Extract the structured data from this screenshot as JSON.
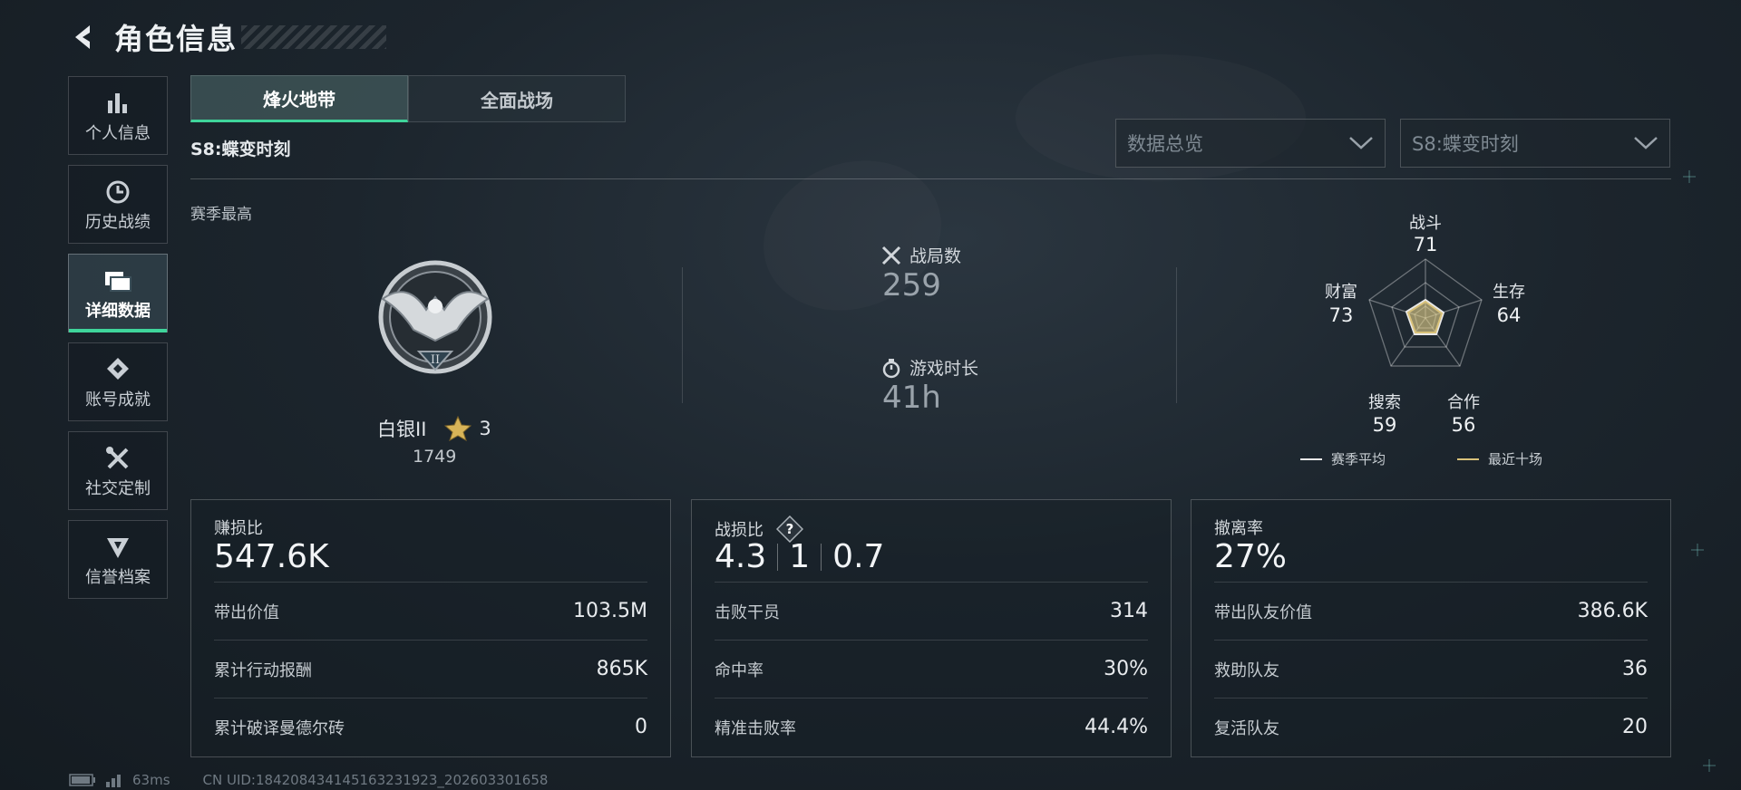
{
  "header": {
    "title": "角色信息"
  },
  "sidebar": {
    "items": [
      {
        "label": "个人信息",
        "icon": "bar-chart-icon"
      },
      {
        "label": "历史战绩",
        "icon": "history-clock-icon"
      },
      {
        "label": "详细数据",
        "icon": "folders-icon",
        "active": true
      },
      {
        "label": "账号成就",
        "icon": "achievement-medal-icon"
      },
      {
        "label": "社交定制",
        "icon": "tools-icon"
      },
      {
        "label": "信誉档案",
        "icon": "credit-shield-icon"
      }
    ]
  },
  "tabs": [
    {
      "label": "烽火地带",
      "active": true
    },
    {
      "label": "全面战场",
      "active": false
    }
  ],
  "season": {
    "label": "S8:蝶变时刻"
  },
  "filters": {
    "category": "数据总览",
    "season": "S8:蝶变时刻"
  },
  "season_best": {
    "label": "赛季最高",
    "rank_name": "白银II",
    "rank_badge_numeral": "II",
    "stars": "3",
    "score": "1749"
  },
  "stats": {
    "matches_label": "战局数",
    "matches_value": "259",
    "playtime_label": "游戏时长",
    "playtime_value": "41h"
  },
  "radar": {
    "axes": [
      {
        "label": "战斗",
        "value": "71"
      },
      {
        "label": "生存",
        "value": "64"
      },
      {
        "label": "合作",
        "value": "56"
      },
      {
        "label": "搜索",
        "value": "59"
      },
      {
        "label": "财富",
        "value": "73"
      }
    ],
    "legend_avg": "赛季平均",
    "legend_recent": "最近十场",
    "avg_color": "#e8e8e8",
    "recent_color": "#d9c27a"
  },
  "cards": [
    {
      "head_label": "赚损比",
      "head_value": "547.6K",
      "rows": [
        {
          "k": "带出价值",
          "v": "103.5M"
        },
        {
          "k": "累计行动报酬",
          "v": "865K"
        },
        {
          "k": "累计破译曼德尔砖",
          "v": "0"
        }
      ]
    },
    {
      "head_label": "战损比",
      "head_values": [
        "4.3",
        "1",
        "0.7"
      ],
      "rows": [
        {
          "k": "击败干员",
          "v": "314"
        },
        {
          "k": "命中率",
          "v": "30%"
        },
        {
          "k": "精准击败率",
          "v": "44.4%"
        }
      ]
    },
    {
      "head_label": "撤离率",
      "head_value": "27%",
      "rows": [
        {
          "k": "带出队友价值",
          "v": "386.6K"
        },
        {
          "k": "救助队友",
          "v": "36"
        },
        {
          "k": "复活队友",
          "v": "20"
        }
      ]
    }
  ],
  "footer": {
    "ping": "63ms",
    "uid": "CN UID:18420843414516323​1923_202603301658"
  },
  "colors": {
    "accent": "#3fd59b"
  }
}
